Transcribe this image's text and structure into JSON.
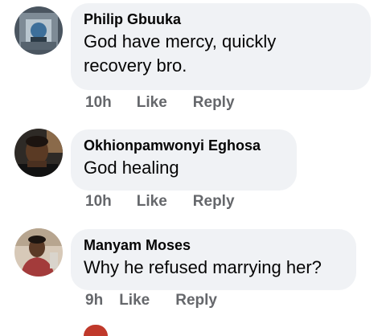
{
  "comments": [
    {
      "author": "Philip Gbuuka",
      "text_line1": "God have mercy, quickly",
      "text_line2": "recovery bro.",
      "time": "10h",
      "like_label": "Like",
      "reply_label": "Reply"
    },
    {
      "author": "Okhionpamwonyi Eghosa",
      "text_line1": "God healing",
      "time": "10h",
      "like_label": "Like",
      "reply_label": "Reply"
    },
    {
      "author": "Manyam Moses",
      "text_line1": "Why he refused marrying her?",
      "time": "9h",
      "like_label": "Like",
      "reply_label": "Reply"
    }
  ],
  "colors": {
    "bubble_background": "#f0f2f5",
    "meta_text": "#65676b",
    "primary_text": "#050505"
  }
}
